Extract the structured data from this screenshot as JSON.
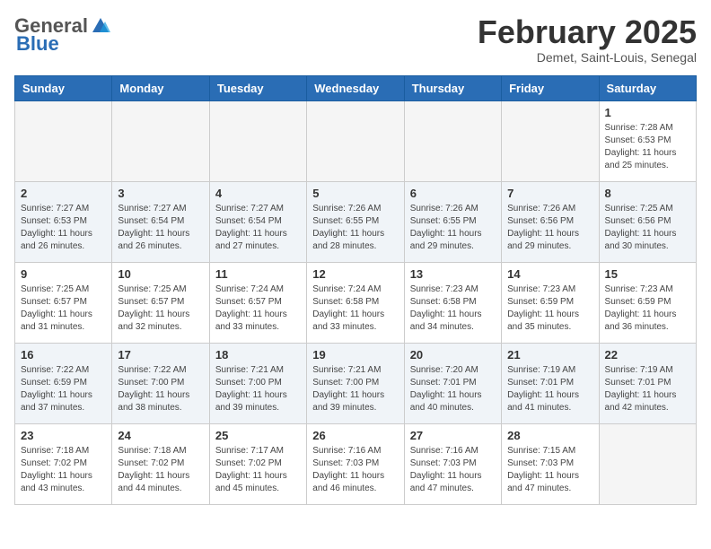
{
  "header": {
    "logo_general": "General",
    "logo_blue": "Blue",
    "month_title": "February 2025",
    "subtitle": "Demet, Saint-Louis, Senegal"
  },
  "weekdays": [
    "Sunday",
    "Monday",
    "Tuesday",
    "Wednesday",
    "Thursday",
    "Friday",
    "Saturday"
  ],
  "weeks": [
    {
      "shaded": false,
      "days": [
        {
          "number": "",
          "info": ""
        },
        {
          "number": "",
          "info": ""
        },
        {
          "number": "",
          "info": ""
        },
        {
          "number": "",
          "info": ""
        },
        {
          "number": "",
          "info": ""
        },
        {
          "number": "",
          "info": ""
        },
        {
          "number": "1",
          "info": "Sunrise: 7:28 AM\nSunset: 6:53 PM\nDaylight: 11 hours and 25 minutes."
        }
      ]
    },
    {
      "shaded": true,
      "days": [
        {
          "number": "2",
          "info": "Sunrise: 7:27 AM\nSunset: 6:53 PM\nDaylight: 11 hours and 26 minutes."
        },
        {
          "number": "3",
          "info": "Sunrise: 7:27 AM\nSunset: 6:54 PM\nDaylight: 11 hours and 26 minutes."
        },
        {
          "number": "4",
          "info": "Sunrise: 7:27 AM\nSunset: 6:54 PM\nDaylight: 11 hours and 27 minutes."
        },
        {
          "number": "5",
          "info": "Sunrise: 7:26 AM\nSunset: 6:55 PM\nDaylight: 11 hours and 28 minutes."
        },
        {
          "number": "6",
          "info": "Sunrise: 7:26 AM\nSunset: 6:55 PM\nDaylight: 11 hours and 29 minutes."
        },
        {
          "number": "7",
          "info": "Sunrise: 7:26 AM\nSunset: 6:56 PM\nDaylight: 11 hours and 29 minutes."
        },
        {
          "number": "8",
          "info": "Sunrise: 7:25 AM\nSunset: 6:56 PM\nDaylight: 11 hours and 30 minutes."
        }
      ]
    },
    {
      "shaded": false,
      "days": [
        {
          "number": "9",
          "info": "Sunrise: 7:25 AM\nSunset: 6:57 PM\nDaylight: 11 hours and 31 minutes."
        },
        {
          "number": "10",
          "info": "Sunrise: 7:25 AM\nSunset: 6:57 PM\nDaylight: 11 hours and 32 minutes."
        },
        {
          "number": "11",
          "info": "Sunrise: 7:24 AM\nSunset: 6:57 PM\nDaylight: 11 hours and 33 minutes."
        },
        {
          "number": "12",
          "info": "Sunrise: 7:24 AM\nSunset: 6:58 PM\nDaylight: 11 hours and 33 minutes."
        },
        {
          "number": "13",
          "info": "Sunrise: 7:23 AM\nSunset: 6:58 PM\nDaylight: 11 hours and 34 minutes."
        },
        {
          "number": "14",
          "info": "Sunrise: 7:23 AM\nSunset: 6:59 PM\nDaylight: 11 hours and 35 minutes."
        },
        {
          "number": "15",
          "info": "Sunrise: 7:23 AM\nSunset: 6:59 PM\nDaylight: 11 hours and 36 minutes."
        }
      ]
    },
    {
      "shaded": true,
      "days": [
        {
          "number": "16",
          "info": "Sunrise: 7:22 AM\nSunset: 6:59 PM\nDaylight: 11 hours and 37 minutes."
        },
        {
          "number": "17",
          "info": "Sunrise: 7:22 AM\nSunset: 7:00 PM\nDaylight: 11 hours and 38 minutes."
        },
        {
          "number": "18",
          "info": "Sunrise: 7:21 AM\nSunset: 7:00 PM\nDaylight: 11 hours and 39 minutes."
        },
        {
          "number": "19",
          "info": "Sunrise: 7:21 AM\nSunset: 7:00 PM\nDaylight: 11 hours and 39 minutes."
        },
        {
          "number": "20",
          "info": "Sunrise: 7:20 AM\nSunset: 7:01 PM\nDaylight: 11 hours and 40 minutes."
        },
        {
          "number": "21",
          "info": "Sunrise: 7:19 AM\nSunset: 7:01 PM\nDaylight: 11 hours and 41 minutes."
        },
        {
          "number": "22",
          "info": "Sunrise: 7:19 AM\nSunset: 7:01 PM\nDaylight: 11 hours and 42 minutes."
        }
      ]
    },
    {
      "shaded": false,
      "days": [
        {
          "number": "23",
          "info": "Sunrise: 7:18 AM\nSunset: 7:02 PM\nDaylight: 11 hours and 43 minutes."
        },
        {
          "number": "24",
          "info": "Sunrise: 7:18 AM\nSunset: 7:02 PM\nDaylight: 11 hours and 44 minutes."
        },
        {
          "number": "25",
          "info": "Sunrise: 7:17 AM\nSunset: 7:02 PM\nDaylight: 11 hours and 45 minutes."
        },
        {
          "number": "26",
          "info": "Sunrise: 7:16 AM\nSunset: 7:03 PM\nDaylight: 11 hours and 46 minutes."
        },
        {
          "number": "27",
          "info": "Sunrise: 7:16 AM\nSunset: 7:03 PM\nDaylight: 11 hours and 47 minutes."
        },
        {
          "number": "28",
          "info": "Sunrise: 7:15 AM\nSunset: 7:03 PM\nDaylight: 11 hours and 47 minutes."
        },
        {
          "number": "",
          "info": ""
        }
      ]
    }
  ]
}
